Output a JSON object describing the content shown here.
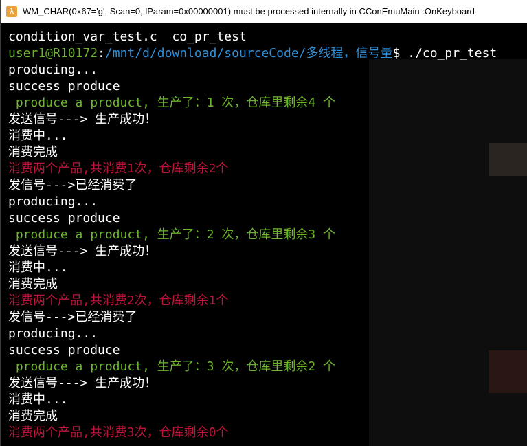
{
  "window": {
    "title": "WM_CHAR(0x67='g', Scan=0, lParam=0x00000001) must be processed internally in CConEmuMain::OnKeyboard",
    "icon": "lambda-icon"
  },
  "console": {
    "files_line": "condition_var_test.c  co_pr_test",
    "prompt": {
      "user": "user1@R10172",
      "colon": ":",
      "path": "/mnt/d/download/sourceCode/多线程，信号量",
      "symbol": "$ ",
      "command": "./co_pr_test"
    },
    "lines": [
      {
        "text": "producing...",
        "color": "white"
      },
      {
        "text": "success produce",
        "color": "white"
      },
      {
        "text": " produce a product, 生产了：1 次，仓库里剩余4 个",
        "color": "green"
      },
      {
        "text": "发送信号---> 生产成功！",
        "color": "white"
      },
      {
        "text": "消费中...",
        "color": "white"
      },
      {
        "text": "消费完成",
        "color": "white"
      },
      {
        "text": "消费两个产品,共消费1次，仓库剩余2个",
        "color": "red"
      },
      {
        "text": "发信号--->已经消费了",
        "color": "white"
      },
      {
        "text": "producing...",
        "color": "white"
      },
      {
        "text": "success produce",
        "color": "white"
      },
      {
        "text": " produce a product, 生产了：2 次，仓库里剩余3 个",
        "color": "green"
      },
      {
        "text": "发送信号---> 生产成功！",
        "color": "white"
      },
      {
        "text": "消费中...",
        "color": "white"
      },
      {
        "text": "消费完成",
        "color": "white"
      },
      {
        "text": "消费两个产品,共消费2次，仓库剩余1个",
        "color": "red"
      },
      {
        "text": "发信号--->已经消费了",
        "color": "white"
      },
      {
        "text": "producing...",
        "color": "white"
      },
      {
        "text": "success produce",
        "color": "white"
      },
      {
        "text": " produce a product, 生产了：3 次，仓库里剩余2 个",
        "color": "green"
      },
      {
        "text": "发送信号---> 生产成功！",
        "color": "white"
      },
      {
        "text": "消费中...",
        "color": "white"
      },
      {
        "text": "消费完成",
        "color": "white"
      },
      {
        "text": "消费两个产品,共消费3次，仓库剩余0个",
        "color": "red"
      }
    ]
  },
  "colors": {
    "background": "#000000",
    "text_white": "#ffffff",
    "text_green": "#6cb52d",
    "text_red": "#c0143c",
    "path_blue": "#2f8fd8"
  }
}
